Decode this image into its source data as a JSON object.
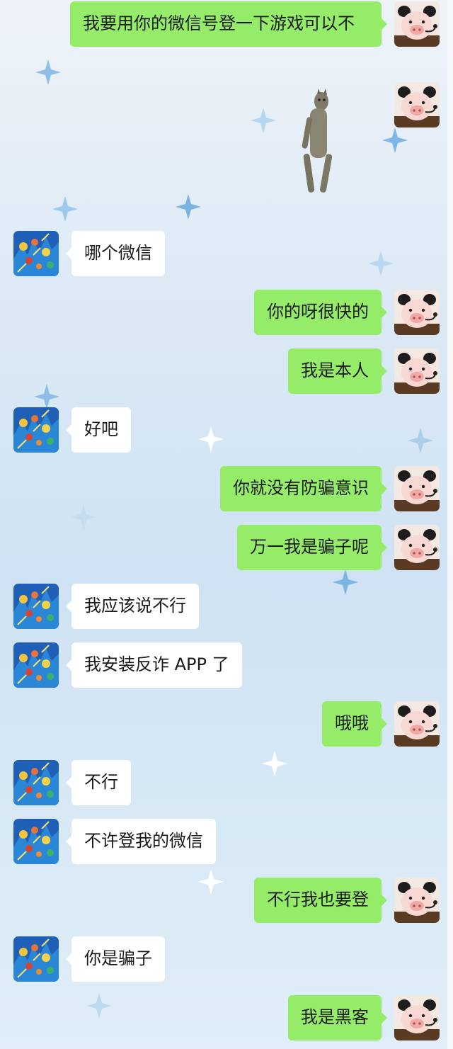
{
  "chat": {
    "messages": [
      {
        "side": "right",
        "text": "我要用你的微信号登一下游戏可以不"
      },
      {
        "side": "right",
        "type": "sticker",
        "icon": "dancing-cat-sticker-icon"
      },
      {
        "side": "left",
        "text": "哪个微信"
      },
      {
        "side": "right",
        "text": "你的呀很快的"
      },
      {
        "side": "right",
        "text": "我是本人"
      },
      {
        "side": "left",
        "text": "好吧"
      },
      {
        "side": "right",
        "text": "你就没有防骗意识"
      },
      {
        "side": "right",
        "text": "万一我是骗子呢"
      },
      {
        "side": "left",
        "text": "我应该说不行"
      },
      {
        "side": "left",
        "text": "我安装反诈 APP 了"
      },
      {
        "side": "right",
        "text": "哦哦"
      },
      {
        "side": "left",
        "text": "不行"
      },
      {
        "side": "left",
        "text": "不许登我的微信"
      },
      {
        "side": "right",
        "text": "不行我也要登"
      },
      {
        "side": "left",
        "text": "你是骗子"
      },
      {
        "side": "right",
        "text": "我是黑客"
      }
    ]
  },
  "theme": {
    "self_bubble_color": "#95ec69",
    "other_bubble_color": "#ffffff",
    "text_color": "#1a1a1a"
  },
  "icons": {
    "self_avatar": "pig-avatar-icon",
    "other_avatar": "colorful-art-avatar-icon",
    "background": "sparkle-icon"
  }
}
